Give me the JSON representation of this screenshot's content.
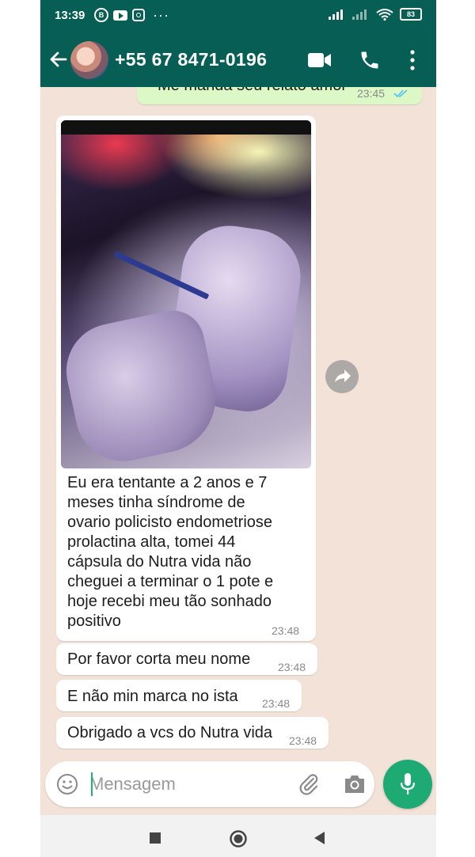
{
  "status_bar": {
    "time": "13:39",
    "battery": "83",
    "more": "···"
  },
  "header": {
    "contact_name": "+55 67 8471-0196"
  },
  "messages": [
    {
      "direction": "out",
      "text": "Me manda seu relato amor",
      "time": "23:45"
    },
    {
      "direction": "in",
      "type": "image",
      "caption_lines": [
        "Eu era tentante a 2 anos e 7",
        "meses tinha síndrome de",
        "ovario policisto endometriose",
        "prolactina alta, tomei 44",
        "cápsula do Nutra vida não",
        "cheguei a terminar o 1 pote e",
        "hoje recebi meu tão sonhado",
        "positivo"
      ],
      "time": "23:48"
    },
    {
      "direction": "in",
      "text": "Por favor corta meu nome",
      "time": "23:48"
    },
    {
      "direction": "in",
      "text": "E não min marca no ista",
      "time": "23:48"
    },
    {
      "direction": "in",
      "text": "Obrigado a vcs do Nutra vida",
      "time": "23:48"
    }
  ],
  "composer": {
    "placeholder": "Mensagem"
  },
  "colors": {
    "header": "#075e54",
    "chat_background": "#f3e2d8",
    "outgoing_bubble": "#dcf8c6",
    "mic_button": "#1daa73",
    "read_ticks": "#4fc3f7"
  }
}
